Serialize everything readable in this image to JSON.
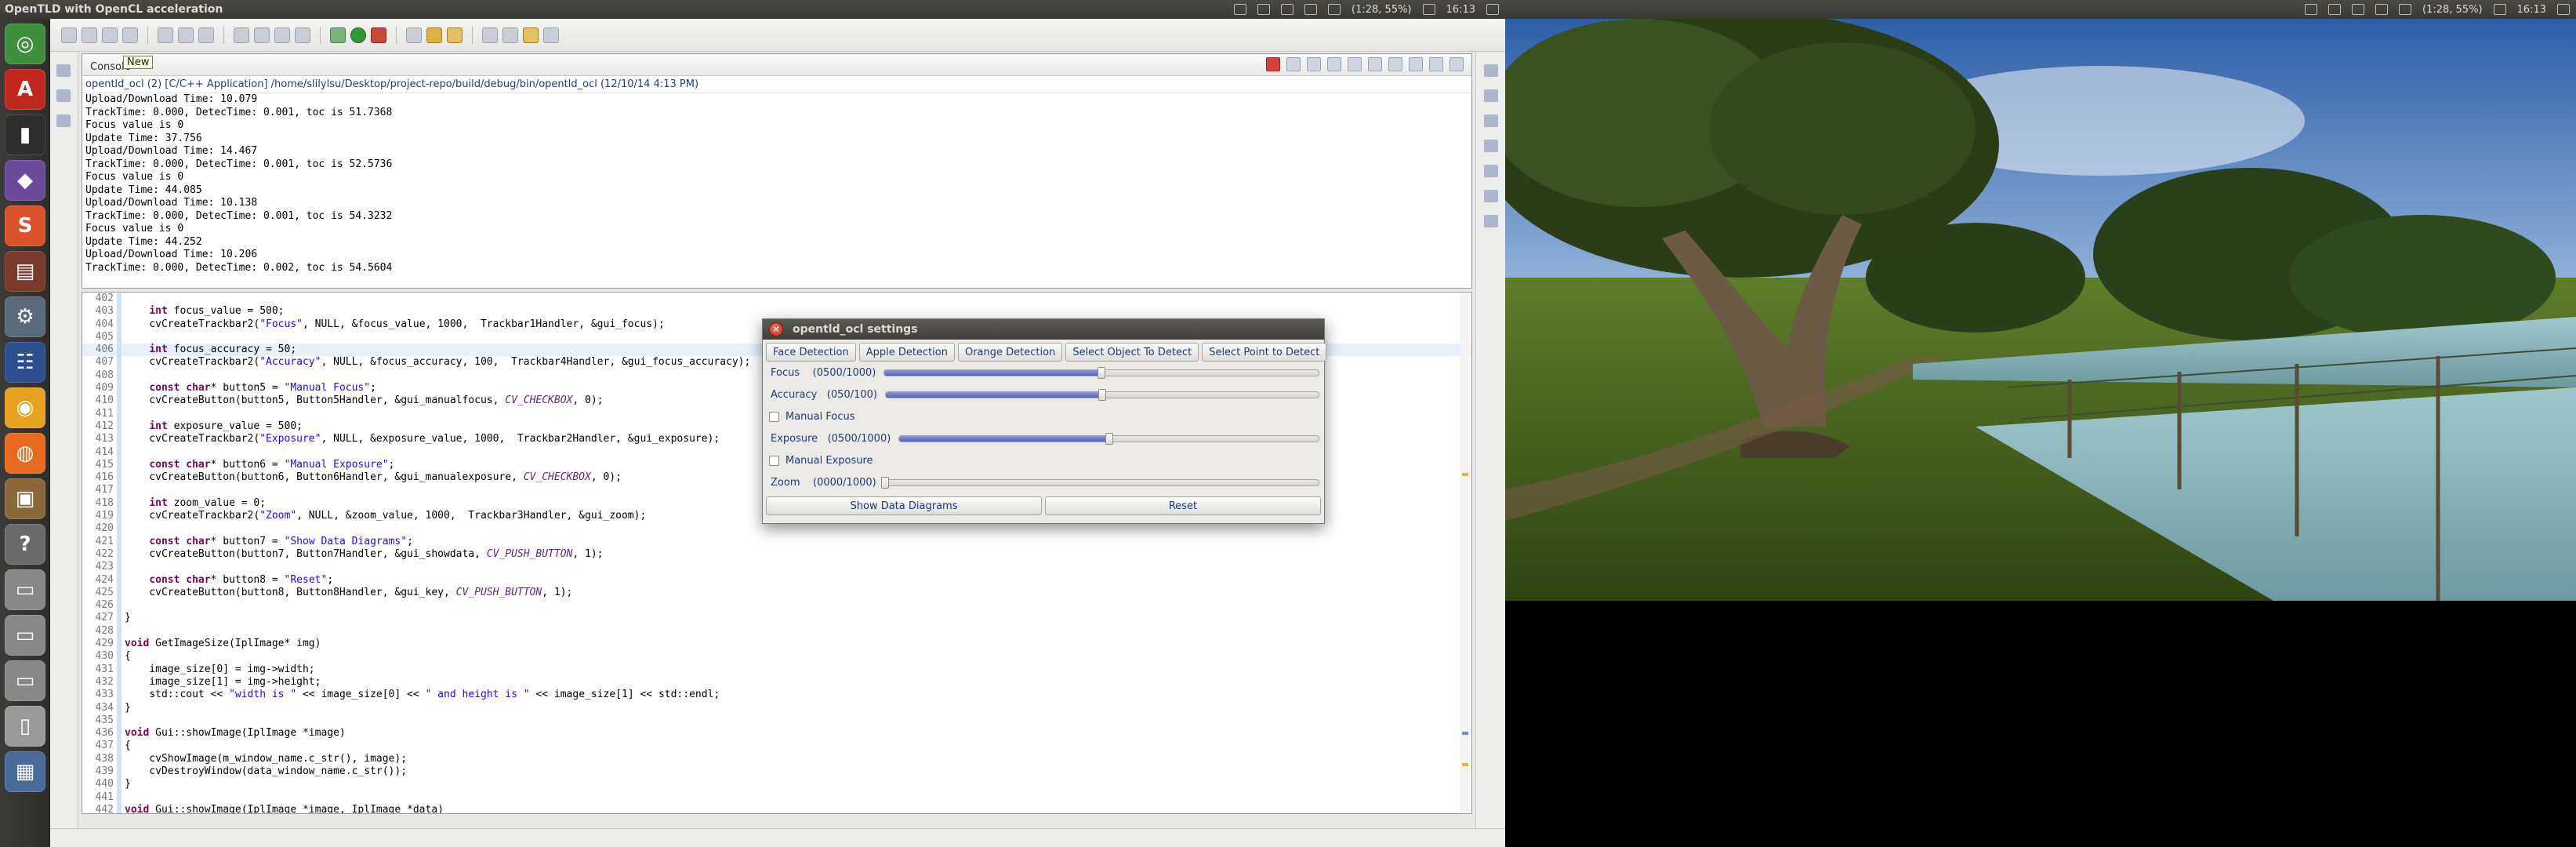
{
  "left_panel": {
    "title": "OpenTLD with OpenCL acceleration",
    "tray_text": "(1:28, 55%)",
    "clock": "16:13"
  },
  "right_panel": {
    "tray_text": "(1:28, 55%)",
    "clock": "16:13"
  },
  "launcher": {
    "items": [
      "dash-home",
      "acrobat-reader",
      "terminal",
      "unity-3d",
      "sublime-text",
      "text-editor",
      "settings",
      "eclipse",
      "chrome",
      "firefox",
      "files",
      "help",
      "drive-1",
      "drive-2",
      "drive-3",
      "usb-drive",
      "workspace-switcher"
    ]
  },
  "console": {
    "tab_label": "Console",
    "tooltip": "New",
    "path": "opentld_ocl (2) [C/C++ Application] /home/slilylsu/Desktop/project-repo/build/debug/bin/opentld_ocl (12/10/14 4:13 PM)",
    "lines": [
      "Upload/Download Time: 10.079",
      "TrackTime: 0.000, DetecTime: 0.001, toc is 51.7368",
      "Focus value is 0",
      "Update Time: 37.756",
      "Upload/Download Time: 14.467",
      "TrackTime: 0.000, DetecTime: 0.001, toc is 52.5736",
      "Focus value is 0",
      "Update Time: 44.085",
      "Upload/Download Time: 10.138",
      "TrackTime: 0.000, DetecTime: 0.001, toc is 54.3232",
      "Focus value is 0",
      "Update Time: 44.252",
      "Upload/Download Time: 10.206",
      "TrackTime: 0.000, DetecTime: 0.002, toc is 54.5604"
    ]
  },
  "editor": {
    "lines": [
      {
        "n": "402",
        "t": ""
      },
      {
        "n": "403",
        "t": "    int focus_value = 500;"
      },
      {
        "n": "404",
        "t": "    cvCreateTrackbar2(\"Focus\", NULL, &focus_value, 1000,  Trackbar1Handler, &gui_focus);"
      },
      {
        "n": "405",
        "t": ""
      },
      {
        "n": "406",
        "t": "    int focus_accuracy = 50;",
        "hl": true
      },
      {
        "n": "407",
        "t": "    cvCreateTrackbar2(\"Accuracy\", NULL, &focus_accuracy, 100,  Trackbar4Handler, &gui_focus_accuracy);"
      },
      {
        "n": "408",
        "t": ""
      },
      {
        "n": "409",
        "t": "    const char* button5 = \"Manual Focus\";"
      },
      {
        "n": "410",
        "t": "    cvCreateButton(button5, Button5Handler, &gui_manualfocus, CV_CHECKBOX, 0);"
      },
      {
        "n": "411",
        "t": ""
      },
      {
        "n": "412",
        "t": "    int exposure_value = 500;"
      },
      {
        "n": "413",
        "t": "    cvCreateTrackbar2(\"Exposure\", NULL, &exposure_value, 1000,  Trackbar2Handler, &gui_exposure);"
      },
      {
        "n": "414",
        "t": ""
      },
      {
        "n": "415",
        "t": "    const char* button6 = \"Manual Exposure\";"
      },
      {
        "n": "416",
        "t": "    cvCreateButton(button6, Button6Handler, &gui_manualexposure, CV_CHECKBOX, 0);"
      },
      {
        "n": "417",
        "t": ""
      },
      {
        "n": "418",
        "t": "    int zoom_value = 0;"
      },
      {
        "n": "419",
        "t": "    cvCreateTrackbar2(\"Zoom\", NULL, &zoom_value, 1000,  Trackbar3Handler, &gui_zoom);"
      },
      {
        "n": "420",
        "t": ""
      },
      {
        "n": "421",
        "t": "    const char* button7 = \"Show Data Diagrams\";"
      },
      {
        "n": "422",
        "t": "    cvCreateButton(button7, Button7Handler, &gui_showdata, CV_PUSH_BUTTON, 1);"
      },
      {
        "n": "423",
        "t": ""
      },
      {
        "n": "424",
        "t": "    const char* button8 = \"Reset\";"
      },
      {
        "n": "425",
        "t": "    cvCreateButton(button8, Button8Handler, &gui_key, CV_PUSH_BUTTON, 1);"
      },
      {
        "n": "426",
        "t": ""
      },
      {
        "n": "427",
        "t": "}"
      },
      {
        "n": "428",
        "t": ""
      },
      {
        "n": "429",
        "t": "void GetImageSize(IplImage* img)"
      },
      {
        "n": "430",
        "t": "{"
      },
      {
        "n": "431",
        "t": "    image_size[0] = img->width;"
      },
      {
        "n": "432",
        "t": "    image_size[1] = img->height;"
      },
      {
        "n": "433",
        "t": "    std::cout << \"width is \" << image_size[0] << \" and height is \" << image_size[1] << std::endl;"
      },
      {
        "n": "434",
        "t": "}"
      },
      {
        "n": "435",
        "t": ""
      },
      {
        "n": "436",
        "t": "void Gui::showImage(IplImage *image)"
      },
      {
        "n": "437",
        "t": "{"
      },
      {
        "n": "438",
        "t": "    cvShowImage(m_window_name.c_str(), image);"
      },
      {
        "n": "439",
        "t": "    cvDestroyWindow(data_window_name.c_str());"
      },
      {
        "n": "440",
        "t": "}"
      },
      {
        "n": "441",
        "t": ""
      },
      {
        "n": "442",
        "t": "void Gui::showImage(IplImage *image, IplImage *data)"
      }
    ]
  },
  "dialog": {
    "title": "opentld_ocl settings",
    "top_buttons": [
      "Face Detection",
      "Apple Detection",
      "Orange Detection",
      "Select Object To Detect",
      "Select Point to Detect"
    ],
    "focus": {
      "label": "Focus",
      "value_text": "(0500/1000)",
      "fraction": 0.5
    },
    "accuracy": {
      "label": "Accuracy",
      "value_text": "(050/100)",
      "fraction": 0.5
    },
    "manual_focus": "Manual Focus",
    "exposure": {
      "label": "Exposure",
      "value_text": "(0500/1000)",
      "fraction": 0.5
    },
    "manual_exposure": "Manual Exposure",
    "zoom": {
      "label": "Zoom",
      "value_text": "(0000/1000)",
      "fraction": 0.0
    },
    "show_data_button": "Show Data Diagrams",
    "reset_button": "Reset"
  }
}
